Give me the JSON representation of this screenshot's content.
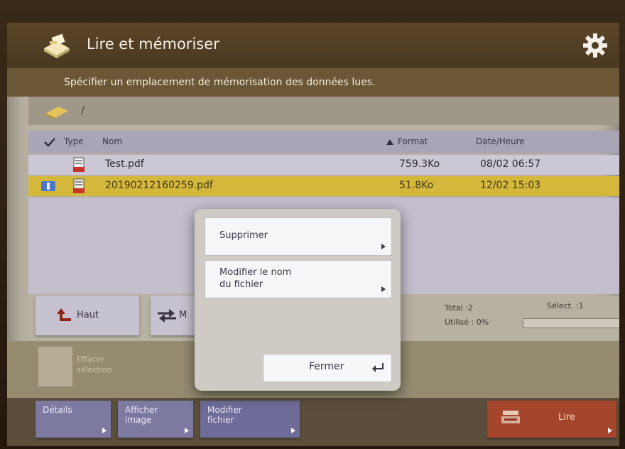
{
  "window": {
    "title": "Lire et mémoriser"
  },
  "subtitle": "Spécifier un emplacement de mémorisation des données lues.",
  "path": "/",
  "table": {
    "headers": {
      "type": "Type",
      "name": "Nom",
      "format": "Format",
      "date": "Date/Heure"
    },
    "rows": [
      {
        "name": "Test.pdf",
        "format": "759.3Ko",
        "date": "08/02  06:57",
        "selected": false
      },
      {
        "name": "20190212160259.pdf",
        "format": "51.8Ko",
        "date": "12/02  15:03",
        "selected": true
      }
    ]
  },
  "nav": {
    "up_label": "Haut",
    "move_label": "M"
  },
  "stats": {
    "total": "Total :2",
    "used": "Utilisé : 0%",
    "selected": "Sélect. :1"
  },
  "clear": {
    "label": "Effacer sélection"
  },
  "bottom": {
    "details": "Détails",
    "show_image": "Afficher image",
    "modify_file": "Modifier fichier",
    "read": "Lire"
  },
  "dialog": {
    "delete": "Supprimer",
    "rename_line1": "Modifier le nom",
    "rename_line2": "du fichier",
    "close": "Fermer"
  },
  "colors": {
    "title_bar": "#5b4528",
    "selected_row": "#d4b83c",
    "bottom_button": "#7d7aa2",
    "read_button": "#a4452c"
  }
}
